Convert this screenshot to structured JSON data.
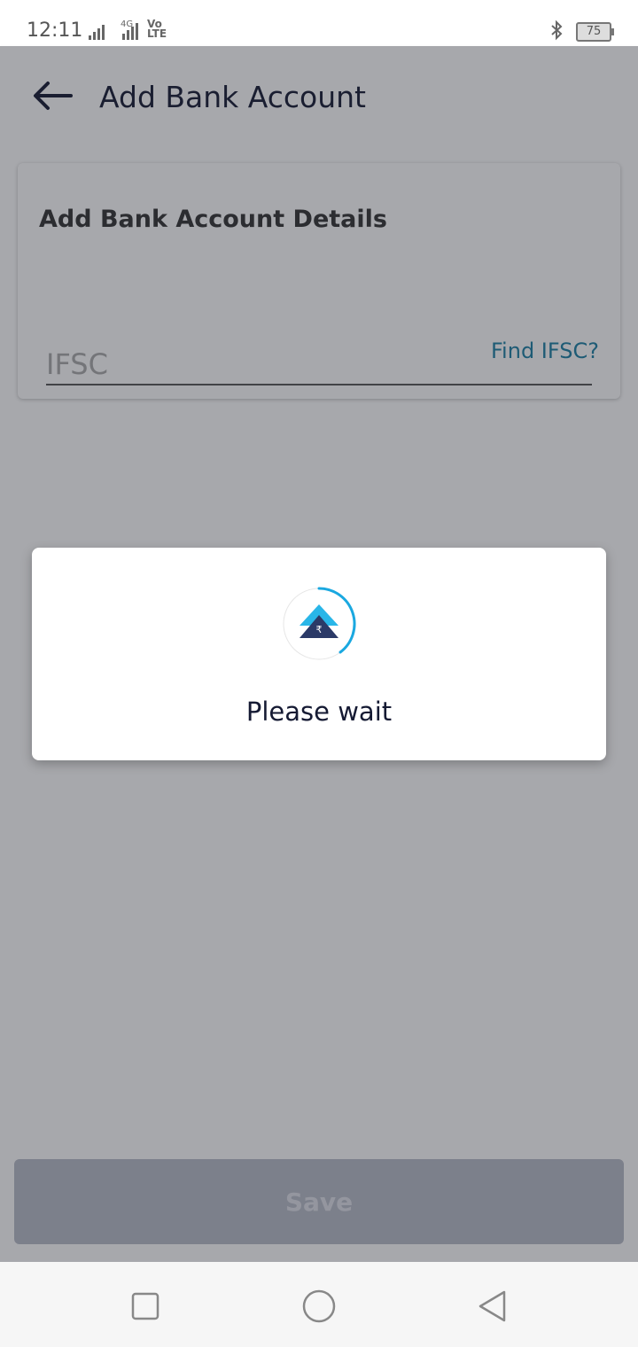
{
  "status_bar": {
    "time": "12:11",
    "network_label": "4G",
    "volte_label": "Vo\nLTE",
    "battery_level": "75",
    "icons": [
      "signal-icon",
      "bluetooth-icon",
      "battery-icon"
    ]
  },
  "app_bar": {
    "title": "Add Bank Account",
    "back_icon": "arrow-left-icon"
  },
  "card": {
    "title": "Add Bank Account Details",
    "ifsc_placeholder": "IFSC",
    "ifsc_value": "",
    "find_ifsc_label": "Find IFSC?"
  },
  "save_button": {
    "label": "Save"
  },
  "dialog": {
    "message": "Please wait",
    "loader_icon": "rupee-logo-spinner-icon"
  },
  "nav_bar": {
    "items": [
      "recents-square-icon",
      "home-circle-icon",
      "back-triangle-icon"
    ]
  },
  "colors": {
    "accent": "#1b7fa4",
    "title_text": "#151a33",
    "spinner": "#1aa8e0",
    "logo_dark": "#2b3a67",
    "logo_light": "#29b6e8"
  }
}
